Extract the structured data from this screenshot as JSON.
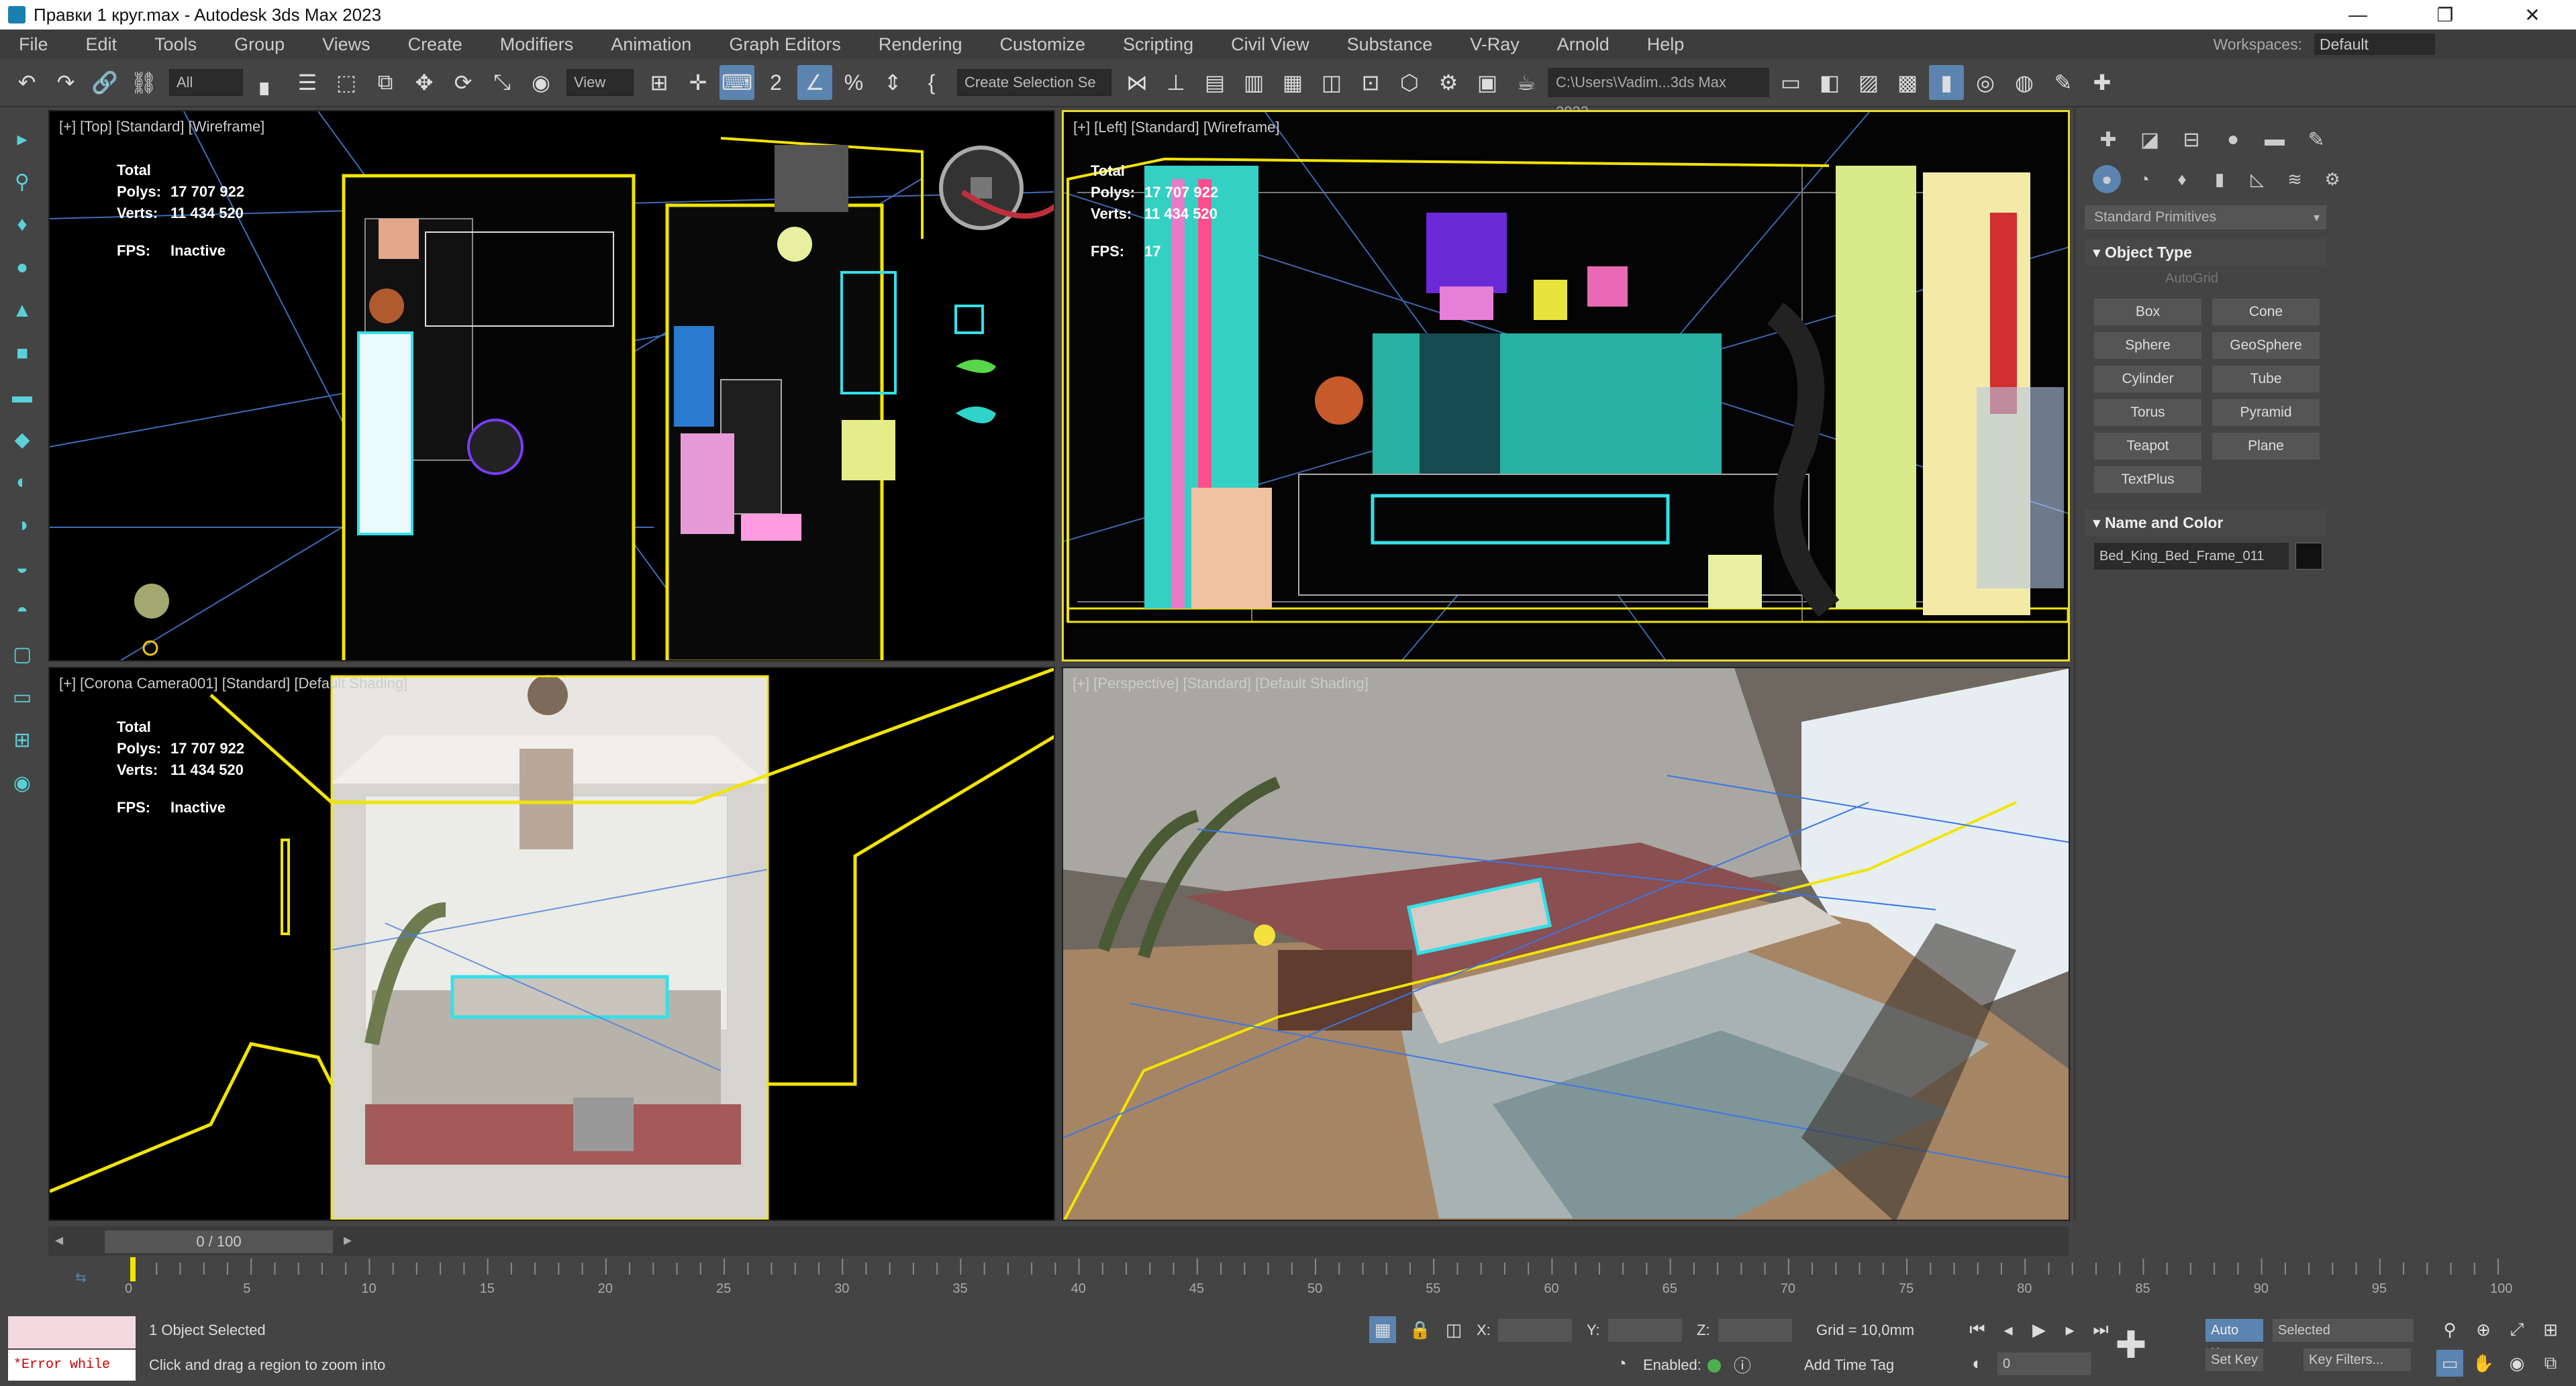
{
  "window": {
    "title": "Правки 1 круг.max - Autodesk 3ds Max 2023",
    "controls": [
      "—",
      "❐",
      "✕"
    ]
  },
  "menu": [
    "File",
    "Edit",
    "Tools",
    "Group",
    "Views",
    "Create",
    "Modifiers",
    "Animation",
    "Graph Editors",
    "Rendering",
    "Customize",
    "Scripting",
    "Civil View",
    "Substance",
    "V-Ray",
    "Arnold",
    "Help"
  ],
  "workspaces": {
    "label": "Workspaces:",
    "value": "Default"
  },
  "toolbar": {
    "selection_filter": "All",
    "ref_coord": "View",
    "named_selection": "Create Selection Se",
    "project_path": "C:\\Users\\Vadim...3ds Max 2023"
  },
  "viewports": {
    "top": {
      "label": "[+] [Top] [Standard] [Wireframe]",
      "stats": {
        "total": "Total",
        "polys_label": "Polys:",
        "polys": "17 707 922",
        "verts_label": "Verts:",
        "verts": "11 434 520",
        "fps_label": "FPS:",
        "fps": "Inactive"
      }
    },
    "left": {
      "label": "[+] [Left] [Standard] [Wireframe]",
      "stats": {
        "total": "Total",
        "polys_label": "Polys:",
        "polys": "17 707 922",
        "verts_label": "Verts:",
        "verts": "11 434 520",
        "fps_label": "FPS:",
        "fps": "17"
      }
    },
    "camera": {
      "label": "[+] [Corona Camera001] [Standard] [Default Shading]",
      "stats": {
        "total": "Total",
        "polys_label": "Polys:",
        "polys": "17 707 922",
        "verts_label": "Verts:",
        "verts": "11 434 520",
        "fps_label": "FPS:",
        "fps": "Inactive"
      }
    },
    "perspective": {
      "label": "[+] [Perspective] [Standard] [Default Shading]"
    }
  },
  "command_panel": {
    "dropdown": "Standard Primitives",
    "object_type_header": "Object Type",
    "autogrid": "AutoGrid",
    "object_buttons": [
      "Box",
      "Cone",
      "Sphere",
      "GeoSphere",
      "Cylinder",
      "Tube",
      "Torus",
      "Pyramid",
      "Teapot",
      "Plane",
      "TextPlus"
    ],
    "name_color_header": "Name and Color",
    "object_name": "Bed_King_Bed_Frame_011",
    "object_color": "#111111"
  },
  "timeline": {
    "frame_display": "0 / 100",
    "ticks": [
      "0",
      "5",
      "10",
      "15",
      "20",
      "25",
      "30",
      "35",
      "40",
      "45",
      "50",
      "55",
      "60",
      "65",
      "70",
      "75",
      "80",
      "85",
      "90",
      "95",
      "100"
    ]
  },
  "status": {
    "maxscript_error": "*Error while",
    "selection": "1 Object Selected",
    "prompt": "Click and drag a region to zoom into",
    "x_label": "X:",
    "y_label": "Y:",
    "z_label": "Z:",
    "grid": "Grid = 10,0mm",
    "enabled": "Enabled:",
    "add_time_tag": "Add Time Tag",
    "auto_key": "Auto Key",
    "set_key": "Set Key",
    "selected": "Selected",
    "key_filters": "Key Filters...",
    "current_frame": "0"
  },
  "colors": {
    "accent": "#5b84b1",
    "viewport_border_active": "#e6d92e",
    "wire_yellow": "#f2e400",
    "wire_cyan": "#33e0e8"
  }
}
